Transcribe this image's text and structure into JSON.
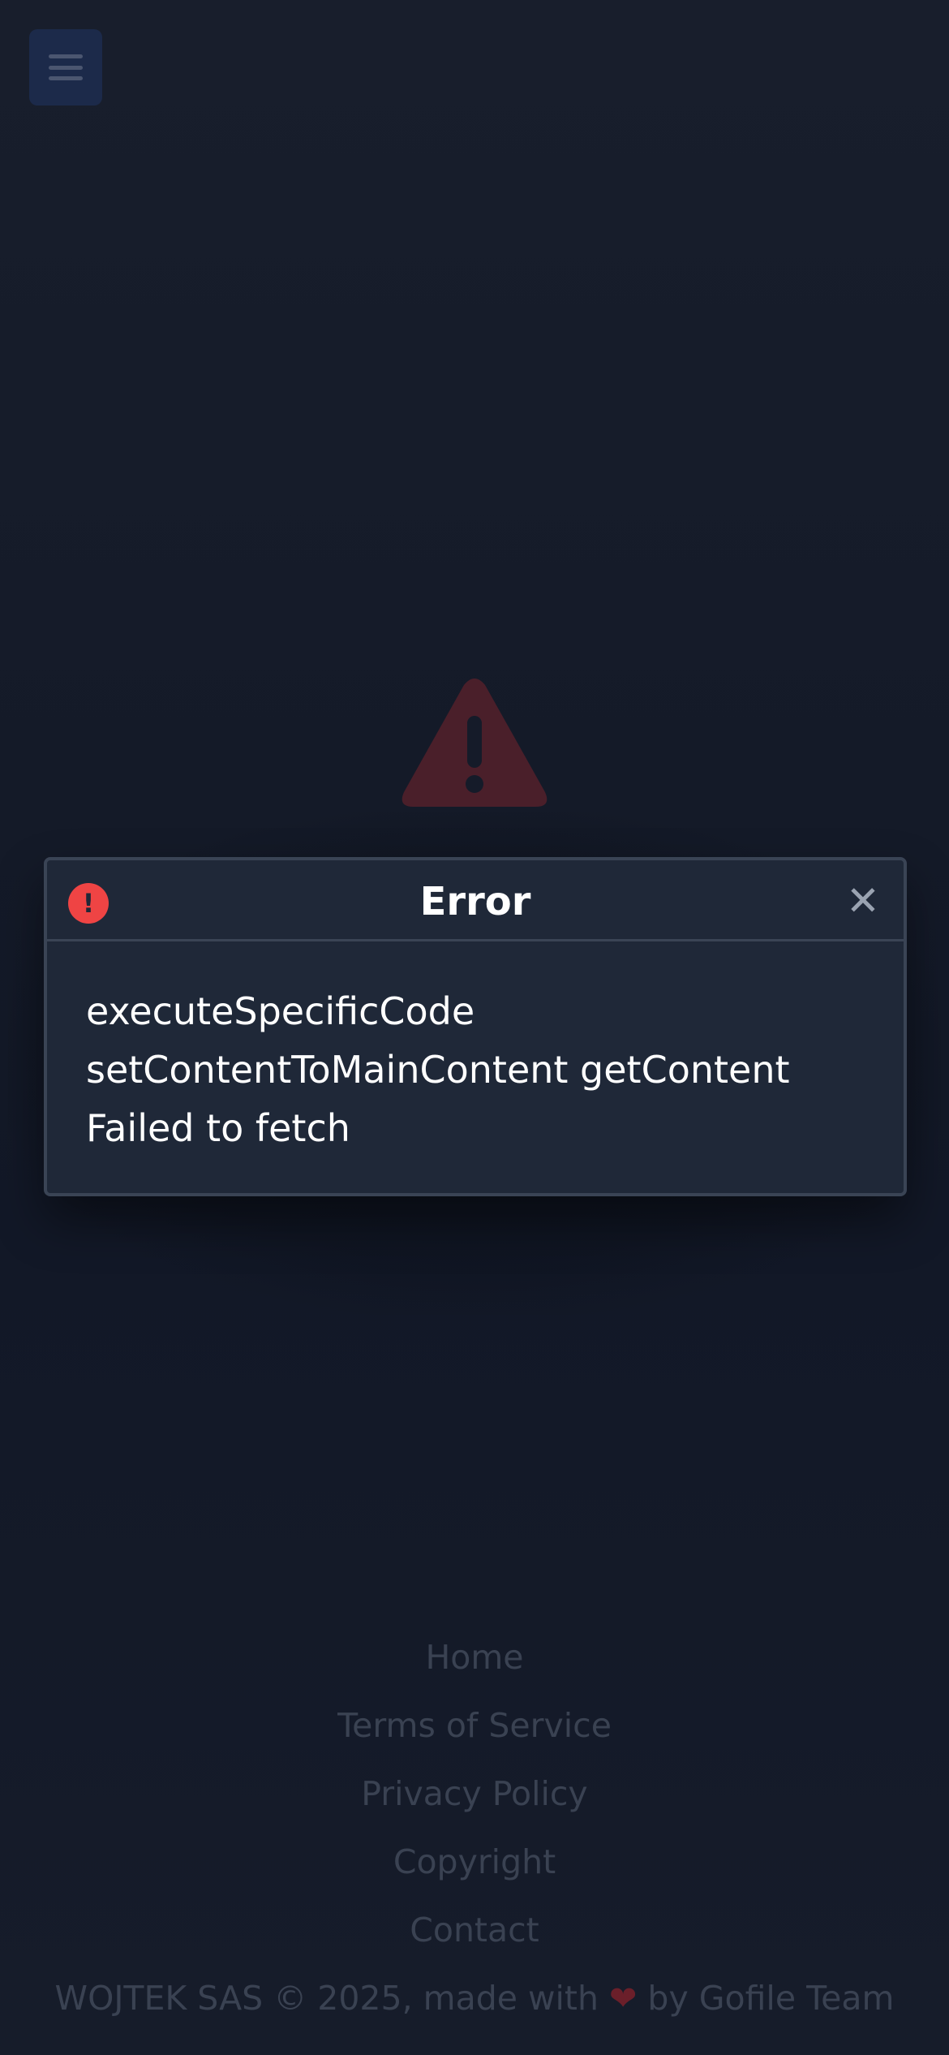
{
  "header": {
    "menu_icon": "hamburger-menu-icon"
  },
  "background": {
    "warning_icon": "warning-triangle-icon",
    "warning_color": "#4a1f2a"
  },
  "modal": {
    "title": "Error",
    "status_icon": "exclamation-circle-icon",
    "status_icon_glyph": "!",
    "status_color": "#ef4444",
    "close_icon": "close-x-icon",
    "close_glyph": "✕",
    "message_lines": [
      "executeSpecificCode",
      "setContentToMainContent getContent",
      "Failed to fetch"
    ]
  },
  "footer": {
    "links": [
      "Home",
      "Terms of Service",
      "Privacy Policy",
      "Copyright",
      "Contact"
    ],
    "credit_prefix": "WOJTEK SAS © 2025, made with",
    "heart_icon": "heart-icon",
    "heart_glyph": "❤",
    "credit_suffix": "by Gofile Team"
  },
  "colors": {
    "page_background": "#151b29",
    "modal_background": "#1f2838",
    "modal_border": "#3a4455",
    "footer_text": "#3a4252"
  }
}
